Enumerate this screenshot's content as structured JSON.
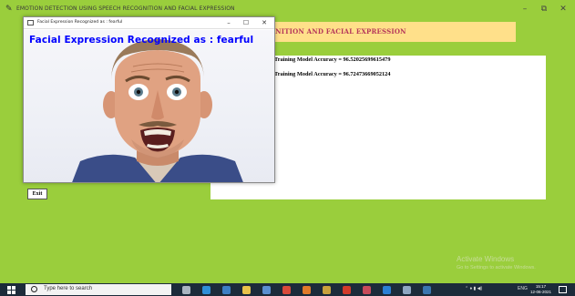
{
  "main_window": {
    "title": "EMOTION DETECTION USING SPEECH RECOGNITION AND FACIAL EXPRESSION",
    "minimize_glyph": "–",
    "maximize_glyph": "⧉",
    "close_glyph": "✕"
  },
  "banner": {
    "text": "GNITION AND FACIAL EXPRESSION"
  },
  "results": {
    "line1": "Training Model Accuracy = 96.52025699615479",
    "line2": "Training Model Accuracy = 96.72473669052124"
  },
  "exit_button": {
    "label": "Exit"
  },
  "popup": {
    "title": "Facial Expression Recognized as : fearful",
    "label": "Facial Expression Recognized as : fearful",
    "minimize_glyph": "–",
    "maximize_glyph": "☐",
    "close_glyph": "✕"
  },
  "watermark": {
    "line1": "Activate Windows",
    "line2": "Go to Settings to activate Windows."
  },
  "taskbar": {
    "search_placeholder": "Type here to search",
    "tray_text": "ENG",
    "clock_time": "15:17",
    "clock_date": "12-06-2021",
    "apps": [
      {
        "icon": "task-view-icon",
        "color": "#aab4c0"
      },
      {
        "icon": "edge-icon",
        "color": "#2f8fd8"
      },
      {
        "icon": "store-icon",
        "color": "#3d7fc4"
      },
      {
        "icon": "file-explorer-icon",
        "color": "#e8c24a"
      },
      {
        "icon": "mail-icon",
        "color": "#5b8fd0"
      },
      {
        "icon": "chrome-icon",
        "color": "#d94a3a"
      },
      {
        "icon": "firefox-icon",
        "color": "#e07a2a"
      },
      {
        "icon": "app-icon",
        "color": "#c9a13c"
      },
      {
        "icon": "pdf-icon",
        "color": "#d23a2a"
      },
      {
        "icon": "paint-icon",
        "color": "#c84a5a"
      },
      {
        "icon": "vscode-icon",
        "color": "#2b7fd4"
      },
      {
        "icon": "notepad-icon",
        "color": "#8fa6c2"
      },
      {
        "icon": "python-icon",
        "color": "#3b76b0"
      }
    ]
  },
  "colors": {
    "background": "#9ace3c",
    "banner": "#ffe08a",
    "banner_text": "#b5365a",
    "popup_label": "#0000ff",
    "taskbar": "#1c2b3a"
  }
}
